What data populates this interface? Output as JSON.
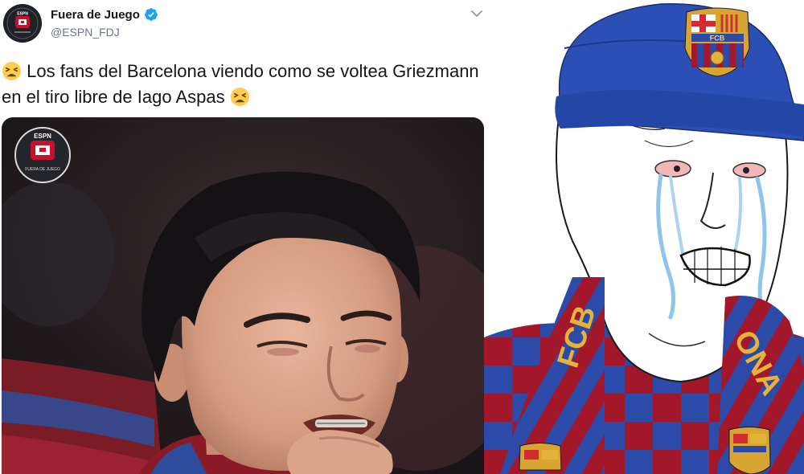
{
  "tweet": {
    "display_name": "Fuera de Juego",
    "handle": "@ESPN_FDJ",
    "text": "Los fans del Barcelona viendo como se voltea Griezmann en el tiro libre de Iago Aspas",
    "avatar_logo": "ESPN",
    "icons": [
      "espn-avatar-logo",
      "verified-badge-icon",
      "chevron-down-icon",
      "tired-face-emoji-icon"
    ]
  },
  "media": {
    "watermark_brand": "ESPN",
    "watermark_caption": "FUERA DE JUEGO"
  },
  "meme": {
    "cap_badge_text": "FCB",
    "scarf_left_text": "FCB",
    "scarf_right_text": "ONA",
    "colors": {
      "blaugrana_blue": "#2c4aa8",
      "blaugrana_red": "#a3172a",
      "cap_blue": "#2b4fb5"
    }
  },
  "colors": {
    "text_primary": "#14171a",
    "text_secondary": "#657786",
    "verified_blue": "#1da1f2"
  }
}
